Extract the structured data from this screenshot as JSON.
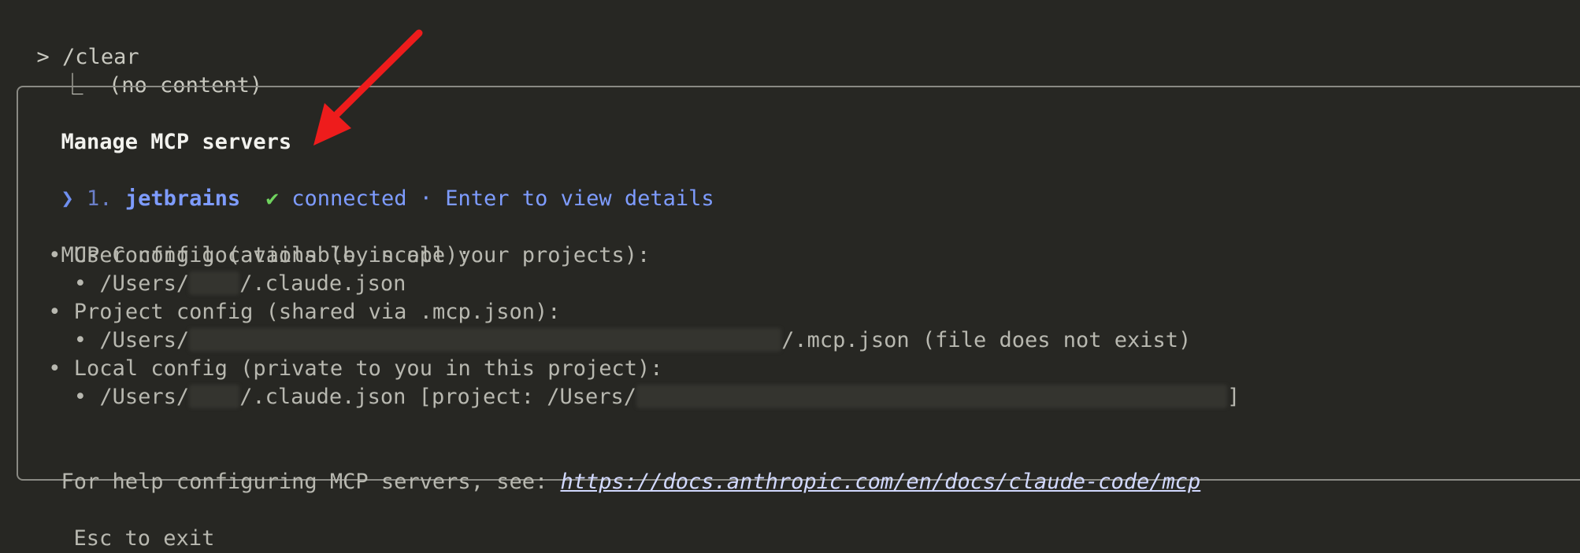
{
  "terminal": {
    "prompt_caret": ">",
    "command": "/clear",
    "tree_glyph": "⎿",
    "command_output": "(no content)"
  },
  "panel": {
    "title": "Manage MCP servers",
    "server": {
      "selector": "❯",
      "index": "1.",
      "name": "jetbrains",
      "check": "✔",
      "status": "connected",
      "hint": "· Enter to view details"
    },
    "config_heading": "MCP Config locations (by scope):",
    "bullet": "•",
    "user_config": {
      "label": "User config (available in all your projects):",
      "path_prefix": "/Users/",
      "path_suffix": "/.claude.json"
    },
    "project_config": {
      "label": "Project config (shared via .mcp.json):",
      "path_prefix": "/Users/",
      "path_suffix": "/.mcp.json (file does not exist)"
    },
    "local_config": {
      "label": "Local config (private to you in this project):",
      "path_prefix": "/Users/",
      "path_middle": "/.claude.json [project: /Users/",
      "path_suffix": "]"
    },
    "help_text": "For help configuring MCP servers, see: ",
    "help_link": "https://docs.anthropic.com/en/docs/claude-code/mcp"
  },
  "footer": {
    "exit_hint": "Esc to exit"
  },
  "colors": {
    "background": "#272723",
    "accent_blue": "#7e9cff",
    "check_green": "#6fd35e",
    "annotation_arrow": "#ee1c1c"
  }
}
